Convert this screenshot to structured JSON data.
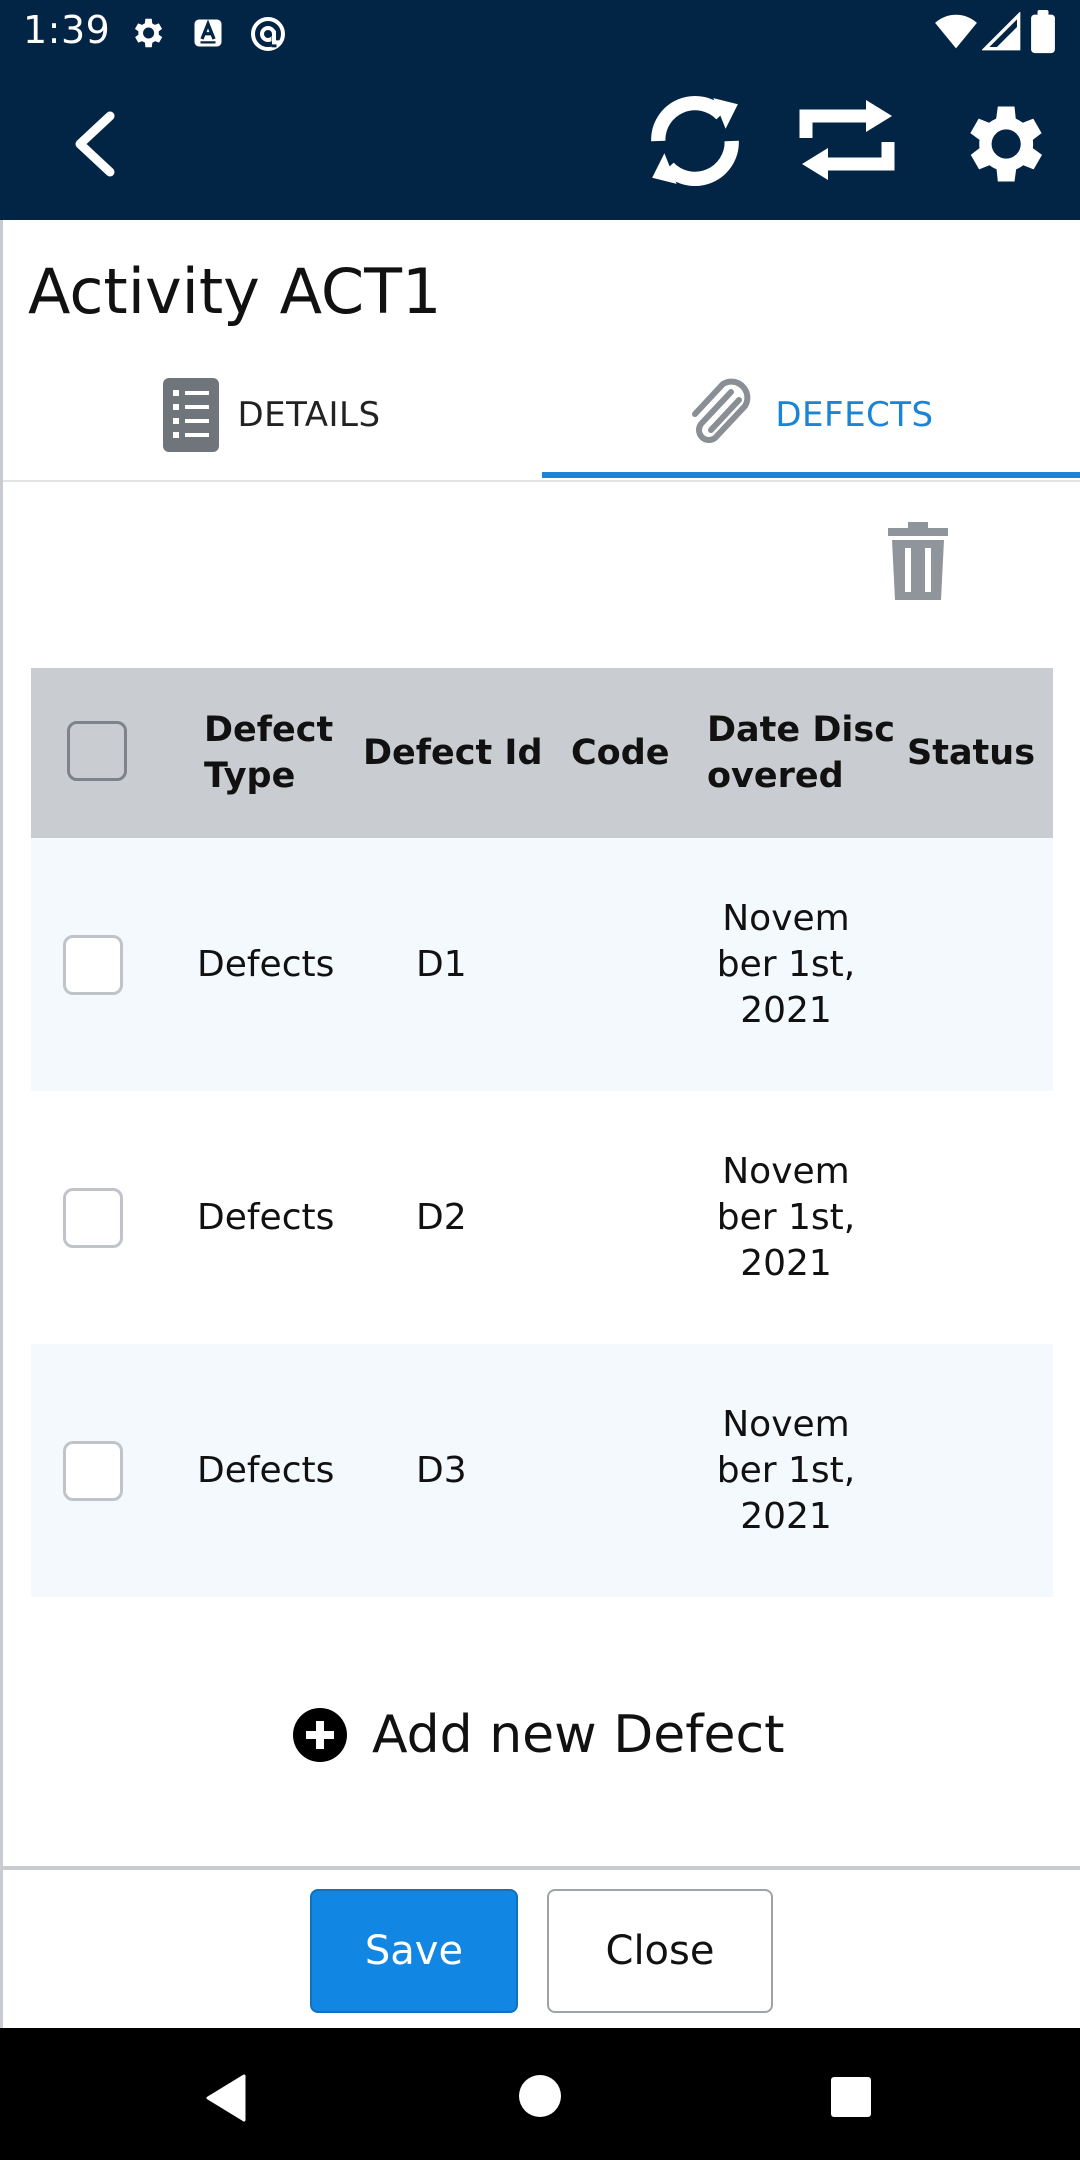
{
  "status_bar": {
    "time": "1:39",
    "icons": [
      "gear-icon",
      "text-a-icon",
      "at-sign-icon",
      "wifi-icon",
      "signal-icon",
      "battery-icon"
    ]
  },
  "app_bar": {
    "back_icon": "chevron-left-icon",
    "sync_icon": "sync-icon",
    "transfer_icon": "repeat-icon",
    "settings_icon": "gear-icon",
    "color": "#022545"
  },
  "page": {
    "title": "Activity ACT1"
  },
  "tabs": [
    {
      "label": "DETAILS",
      "icon": "list-icon",
      "active": false
    },
    {
      "label": "DEFECTS",
      "icon": "paperclip-icon",
      "active": true
    }
  ],
  "toolbar": {
    "delete_icon": "trash-icon"
  },
  "table": {
    "headers": {
      "type_line1": "Defect",
      "type_line2": "Type",
      "id": "Defect Id",
      "code": "Code",
      "date_line1": "Date Disc",
      "date_line2": "overed",
      "status": "Status"
    },
    "rows": [
      {
        "type": "Defects",
        "id": "D1",
        "code": "",
        "date_l1": "Novem",
        "date_l2": "ber 1st,",
        "date_l3": "2021",
        "status": ""
      },
      {
        "type": "Defects",
        "id": "D2",
        "code": "",
        "date_l1": "Novem",
        "date_l2": "ber 1st,",
        "date_l3": "2021",
        "status": ""
      },
      {
        "type": "Defects",
        "id": "D3",
        "code": "",
        "date_l1": "Novem",
        "date_l2": "ber 1st,",
        "date_l3": "2021",
        "status": ""
      }
    ]
  },
  "actions": {
    "add_label": "Add new Defect",
    "add_icon": "plus-circle-icon",
    "save_label": "Save",
    "close_label": "Close"
  },
  "colors": {
    "accent": "#1a84d6",
    "save_button": "#1187e3",
    "header_bg": "#c9ccd0",
    "row_alt_bg": "#f3f9fd"
  }
}
